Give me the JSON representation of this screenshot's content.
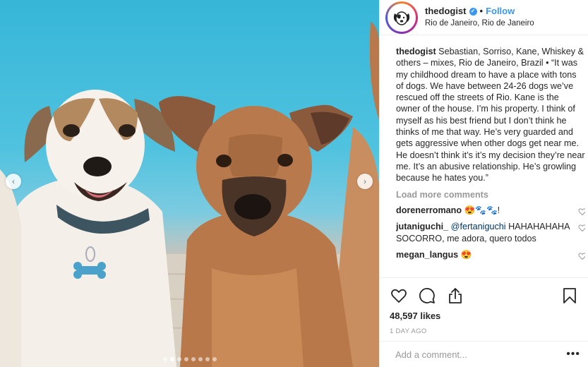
{
  "post": {
    "username": "thedogist",
    "follow_label": "Follow",
    "separator": "•",
    "location": "Rio de Janeiro, Rio de Janeiro",
    "caption_username": "thedogist",
    "caption_text": "Sebastian, Sorriso, Kane, Whiskey & others – mixes, Rio de Janeiro, Brazil • “It was my childhood dream to have a place with tons of dogs. We have between 24-26 dogs we’ve rescued off the streets of Rio. Kane is the owner of the house. I’m his property. I think of myself as his best friend but I don’t think he thinks of me that way. He’s very guarded and gets aggressive when other dogs get near me. He doesn’t think it’s it’s my decision they’re near me. It’s an abusive relationship. He’s growling because he hates you.”",
    "load_more_label": "Load more comments",
    "comments": [
      {
        "user": "dorenerromano",
        "mention": "",
        "text": "😍🐾🐾!"
      },
      {
        "user": "jutaniguchi_",
        "mention": "@fertaniguchi",
        "text": "HAHAHAHAHA SOCORRO, me adora, quero todos"
      },
      {
        "user": "megan_langus",
        "mention": "",
        "text": "😍"
      }
    ],
    "likes": "48,597 likes",
    "time": "1 DAY AGO",
    "add_comment_placeholder": "Add a comment...",
    "more_glyph": "•••"
  },
  "carousel": {
    "prev_glyph": "‹",
    "next_glyph": "›",
    "dot_count": 8,
    "active_dot": 1
  },
  "icons": {
    "like": "heart-icon",
    "comment": "comment-icon",
    "share": "share-icon",
    "save": "bookmark-icon"
  },
  "colors": {
    "link_blue": "#3897f0",
    "muted": "#999999",
    "pool_blue": "#3ab7d8"
  }
}
